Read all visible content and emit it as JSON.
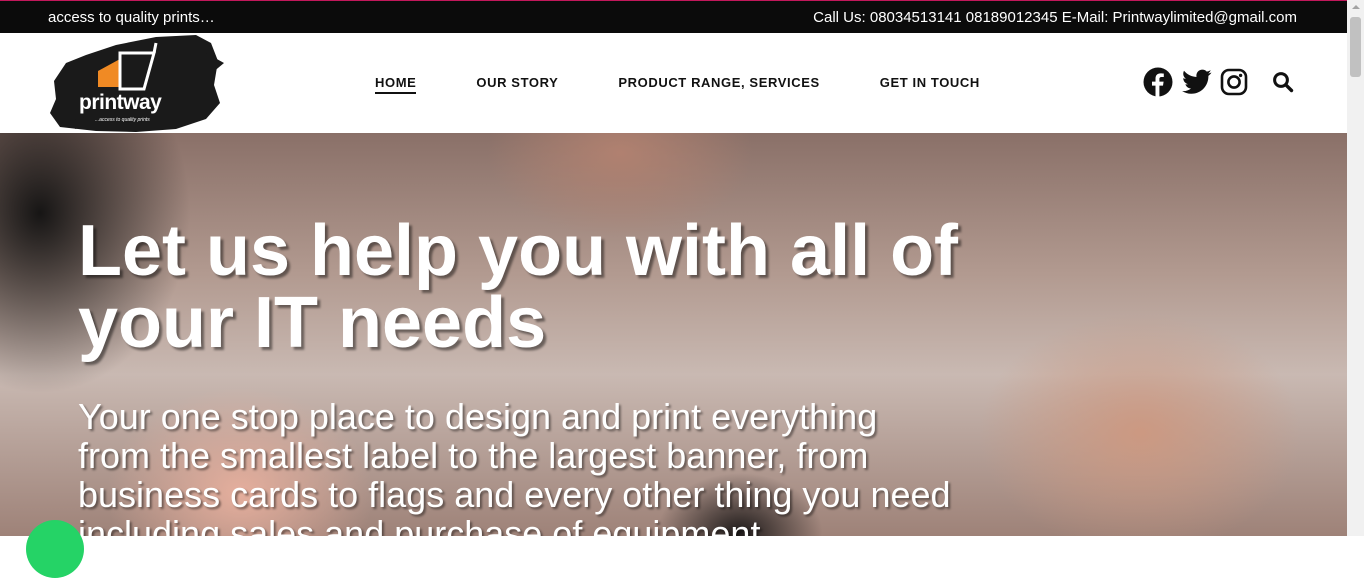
{
  "topbar": {
    "tagline": "access to quality prints…",
    "contact": "Call Us: 08034513141 08189012345 E-Mail: Printwaylimited@gmail.com"
  },
  "logo": {
    "wordmark": "printway",
    "subtitle": "...access to quality prints"
  },
  "nav": {
    "items": [
      {
        "label": "HOME",
        "active": true
      },
      {
        "label": "OUR STORY"
      },
      {
        "label": "PRODUCT RANGE, SERVICES"
      },
      {
        "label": "GET IN TOUCH"
      }
    ]
  },
  "social": {
    "icons": [
      "facebook-icon",
      "twitter-icon",
      "instagram-icon",
      "search-icon"
    ]
  },
  "hero": {
    "heading": "Let us help you with all of your IT needs",
    "subtext": "Your one stop place to design and print everything from the smallest label to the largest banner, from business cards to flags and every other thing you need including sales and purchase of equipment"
  },
  "colors": {
    "topbar_bg": "#0b0b0b",
    "accent_orange": "#f08a24",
    "whatsapp_green": "#25d366",
    "top_border": "#c2185b"
  }
}
